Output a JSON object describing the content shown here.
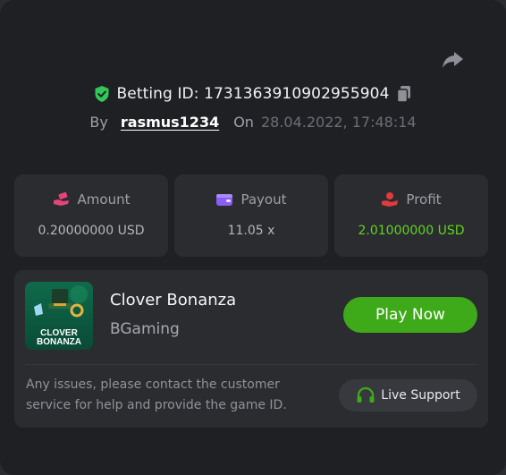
{
  "header": {
    "betting_id_label": "Betting ID: 173136391090295590​4",
    "by_label": "By",
    "username": "rasmus1234",
    "on_label": "On",
    "date": "28.04.2022, 17:48:14"
  },
  "stats": [
    {
      "label": "Amount",
      "value": "0.20000000 USD",
      "icon": "hand-money-icon",
      "color": "#e8447a"
    },
    {
      "label": "Payout",
      "value": "11.05 x",
      "icon": "wallet-icon",
      "color": "#8b5cf6"
    },
    {
      "label": "Profit",
      "value": "2.01000000 USD",
      "icon": "hand-profit-icon",
      "color": "#e23b3b"
    }
  ],
  "game": {
    "title": "Clover Bonanza",
    "provider": "BGaming",
    "thumb_line1": "CLOVER",
    "thumb_line2": "BONANZA",
    "play_label": "Play Now"
  },
  "support": {
    "help_text": "Any issues, please contact the customer service for help and provide the game ID.",
    "live_label": "Live Support"
  },
  "colors": {
    "accent_green": "#3eaa1a",
    "profit_green": "#5fd51f",
    "verified_green": "#34c759"
  }
}
